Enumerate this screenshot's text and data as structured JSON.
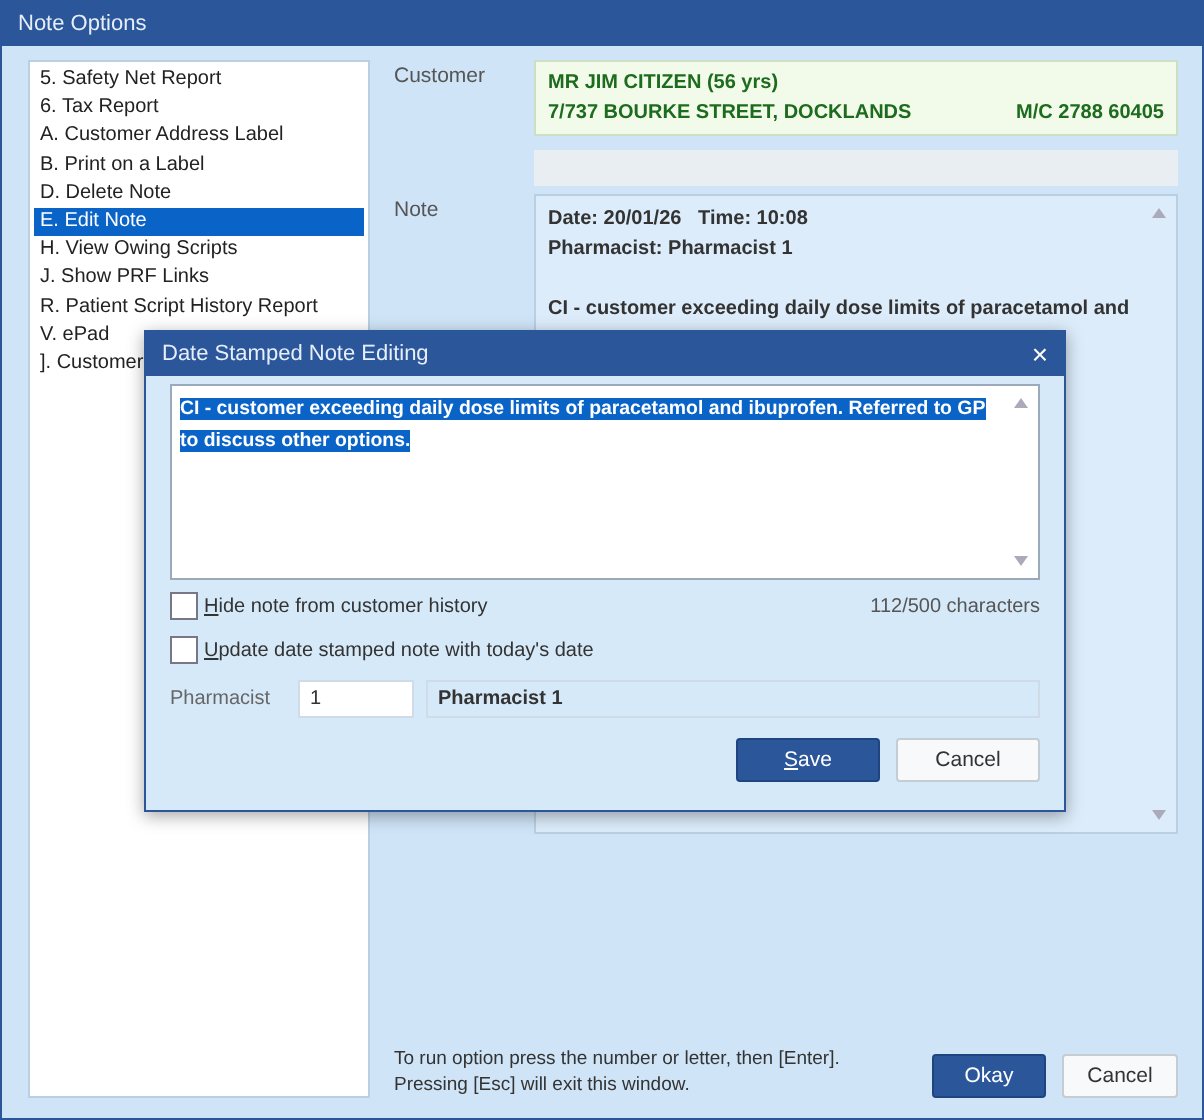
{
  "window": {
    "title": "Note Options"
  },
  "options": [
    {
      "label": "5. Safety Net Report",
      "selected": false
    },
    {
      "label": "6. Tax Report",
      "selected": false
    },
    {
      "label": "A. Customer Address Label",
      "selected": false
    },
    {
      "label": "B. Print on a Label",
      "selected": false
    },
    {
      "label": "D. Delete Note",
      "selected": false
    },
    {
      "label": "E. Edit Note",
      "selected": true
    },
    {
      "label": "H. View Owing Scripts",
      "selected": false
    },
    {
      "label": "J. Show PRF Links",
      "selected": false
    },
    {
      "label": "R. Patient Script History Report",
      "selected": false
    },
    {
      "label": "V. ePad",
      "selected": false
    },
    {
      "label": "]. Customer",
      "selected": false
    }
  ],
  "customer": {
    "label": "Customer",
    "name": "MR JIM CITIZEN  (56 yrs)",
    "address": "7/737 BOURKE STREET, DOCKLANDS",
    "medicare": "M/C 2788 60405"
  },
  "note": {
    "label": "Note",
    "header": [
      "Date: 20/01/26   Time: 10:08",
      "Pharmacist: Pharmacist 1"
    ],
    "body": "CI - customer exceeding daily dose limits of paracetamol and"
  },
  "hint": [
    "To run option press the number or letter, then [Enter].",
    "Pressing [Esc] will exit this window."
  ],
  "buttons": [
    {
      "label": "Okay",
      "primary": true
    },
    {
      "label": "Cancel",
      "primary": false
    }
  ],
  "dialog": {
    "title": "Date Stamped Note Editing",
    "close": "×",
    "text": "CI - customer exceeding daily dose limits of paracetamol and ibuprofen. Referred to GP to discuss other options.",
    "text_selected": true,
    "checkboxes": [
      {
        "label": "Hide note from customer history",
        "checked": false
      },
      {
        "label": "Update date stamped note with today's date",
        "checked": false
      }
    ],
    "counter": "112/500 characters",
    "pharmacist": {
      "label": "Pharmacist",
      "code": "1",
      "name": "Pharmacist 1"
    },
    "buttons": [
      {
        "label": "Save",
        "primary": true
      },
      {
        "label": "Cancel",
        "primary": false
      }
    ]
  }
}
